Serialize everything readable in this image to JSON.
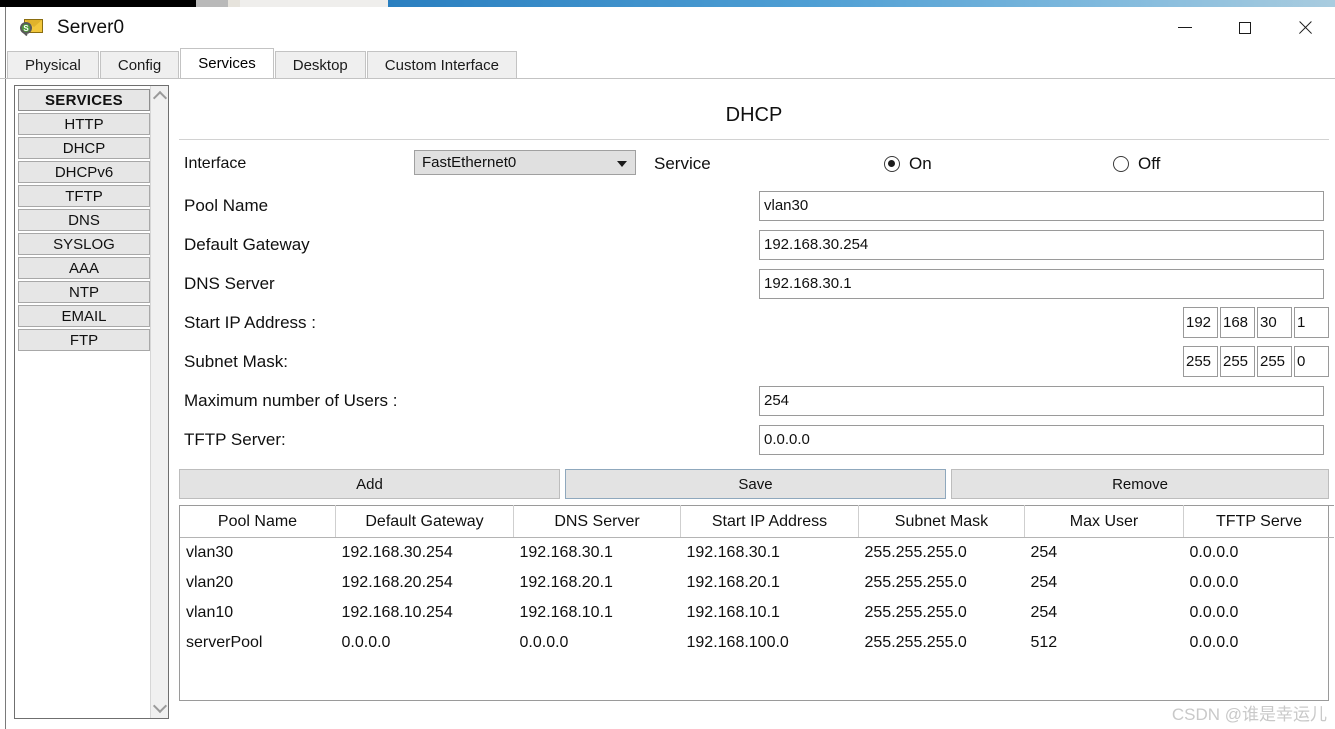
{
  "window": {
    "title": "Server0",
    "icon": "server-envelope-icon",
    "minimize_label": "—",
    "maximize_label": "□",
    "close_label": "✕"
  },
  "tabs": [
    {
      "label": "Physical",
      "active": false
    },
    {
      "label": "Config",
      "active": false
    },
    {
      "label": "Services",
      "active": true
    },
    {
      "label": "Desktop",
      "active": false
    },
    {
      "label": "Custom Interface",
      "active": false
    }
  ],
  "sidebar": {
    "header": "SERVICES",
    "items": [
      {
        "label": "HTTP"
      },
      {
        "label": "DHCP"
      },
      {
        "label": "DHCPv6"
      },
      {
        "label": "TFTP"
      },
      {
        "label": "DNS"
      },
      {
        "label": "SYSLOG"
      },
      {
        "label": "AAA"
      },
      {
        "label": "NTP"
      },
      {
        "label": "EMAIL"
      },
      {
        "label": "FTP"
      }
    ]
  },
  "panel": {
    "title": "DHCP",
    "interface_label": "Interface",
    "interface_value": "FastEthernet0",
    "service_label": "Service",
    "radio_on_label": "On",
    "radio_off_label": "Off",
    "service_state": "On"
  },
  "form": {
    "pool_name_label": "Pool Name",
    "pool_name_value": "vlan30",
    "default_gateway_label": "Default Gateway",
    "default_gateway_value": "192.168.30.254",
    "dns_server_label": "DNS Server",
    "dns_server_value": "192.168.30.1",
    "start_ip_label": "Start IP Address :",
    "start_ip_octets": [
      "192",
      "168",
      "30",
      "1"
    ],
    "subnet_mask_label": "Subnet Mask:",
    "subnet_mask_octets": [
      "255",
      "255",
      "255",
      "0"
    ],
    "max_users_label": "Maximum number of Users :",
    "max_users_value": "254",
    "tftp_server_label": "TFTP Server:",
    "tftp_server_value": "0.0.0.0"
  },
  "buttons": {
    "add": "Add",
    "save": "Save",
    "remove": "Remove"
  },
  "table": {
    "columns": [
      "Pool Name",
      "Default Gateway",
      "DNS Server",
      "Start IP Address",
      "Subnet Mask",
      "Max User",
      "TFTP Serve"
    ],
    "rows": [
      [
        "vlan30",
        "192.168.30.254",
        "192.168.30.1",
        "192.168.30.1",
        "255.255.255.0",
        "254",
        "0.0.0.0"
      ],
      [
        "vlan20",
        "192.168.20.254",
        "192.168.20.1",
        "192.168.20.1",
        "255.255.255.0",
        "254",
        "0.0.0.0"
      ],
      [
        "vlan10",
        "192.168.10.254",
        "192.168.10.1",
        "192.168.10.1",
        "255.255.255.0",
        "254",
        "0.0.0.0"
      ],
      [
        "serverPool",
        "0.0.0.0",
        "0.0.0.0",
        "192.168.100.0",
        "255.255.255.0",
        "512",
        "0.0.0.0"
      ]
    ]
  },
  "watermark": "CSDN @谁是幸运儿"
}
